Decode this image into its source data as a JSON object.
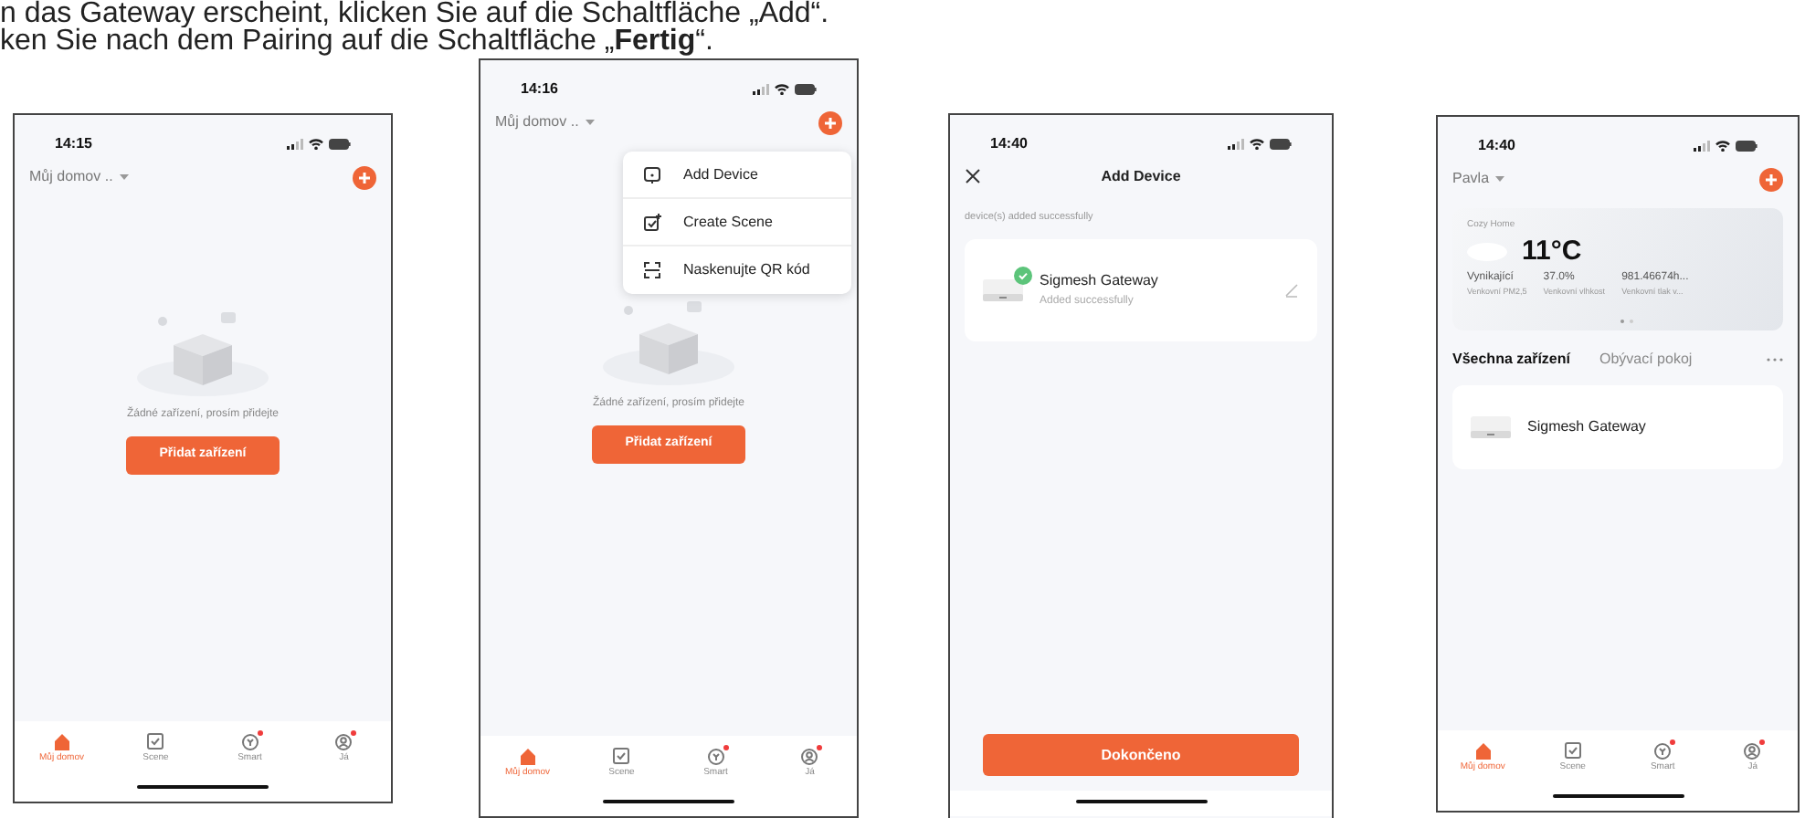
{
  "instructions": [
    {
      "text": "n das Gateway erscheint, klicken Sie auf die Schaltfläche „Add“."
    },
    {
      "text": "ken Sie nach dem Pairing auf die Schaltfläche „**Fertig**“."
    }
  ],
  "phones": [
    {
      "time": "14:15",
      "header": {
        "home": "Můj domov .."
      },
      "empty": {
        "message": "Žádné zařízení, prosím přidejte",
        "button": "Přidat zařízení"
      },
      "tabbar": [
        {
          "label": "Můj domov",
          "selected": true,
          "badge": false
        },
        {
          "label": "Scene",
          "selected": false,
          "badge": false
        },
        {
          "label": "Smart",
          "selected": false,
          "badge": true
        },
        {
          "label": "Já",
          "selected": false,
          "badge": true
        }
      ]
    },
    {
      "time": "14:16",
      "header": {
        "home": "Můj domov .."
      },
      "menu": [
        {
          "kind": "device",
          "label": "Add Device"
        },
        {
          "kind": "scene",
          "label": "Create Scene"
        },
        {
          "kind": "scan",
          "label": "Naskenujte QR kód"
        }
      ],
      "empty": {
        "message": "Žádné zařízení, prosím přidejte",
        "button": "Přidat zařízení"
      },
      "tabbar": [
        {
          "label": "Můj domov",
          "selected": true,
          "badge": false
        },
        {
          "label": "Scene",
          "selected": false,
          "badge": false
        },
        {
          "label": "Smart",
          "selected": false,
          "badge": true
        },
        {
          "label": "Já",
          "selected": false,
          "badge": true
        }
      ]
    },
    {
      "time": "14:40",
      "nav": {
        "title": "Add Device"
      },
      "section_label": "device(s) added successfully",
      "devices": [
        {
          "name": "Sigmesh Gateway",
          "status": "Added successfully",
          "added": true
        }
      ],
      "done_button": "Dokončeno"
    },
    {
      "time": "14:40",
      "header": {
        "home": "Pavla"
      },
      "weather": {
        "place": "Cozy Home",
        "temperature": "11°C",
        "stats": [
          {
            "value": "Vynikající",
            "label": "Venkovní PM2,5"
          },
          {
            "value": "37.0%",
            "label": "Venkovní vlhkost"
          },
          {
            "value": "981.46674h...",
            "label": "Venkovní tlak v..."
          }
        ]
      },
      "rooms": [
        {
          "label": "Všechna zařízení",
          "selected": true
        },
        {
          "label": "Obývací pokoj",
          "selected": false
        }
      ],
      "devices": [
        {
          "name": "Sigmesh Gateway",
          "added": false
        }
      ],
      "tabbar": [
        {
          "label": "Můj domov",
          "selected": true,
          "badge": false
        },
        {
          "label": "Scene",
          "selected": false,
          "badge": false
        },
        {
          "label": "Smart",
          "selected": false,
          "badge": true
        },
        {
          "label": "Já",
          "selected": false,
          "badge": true
        }
      ]
    }
  ]
}
